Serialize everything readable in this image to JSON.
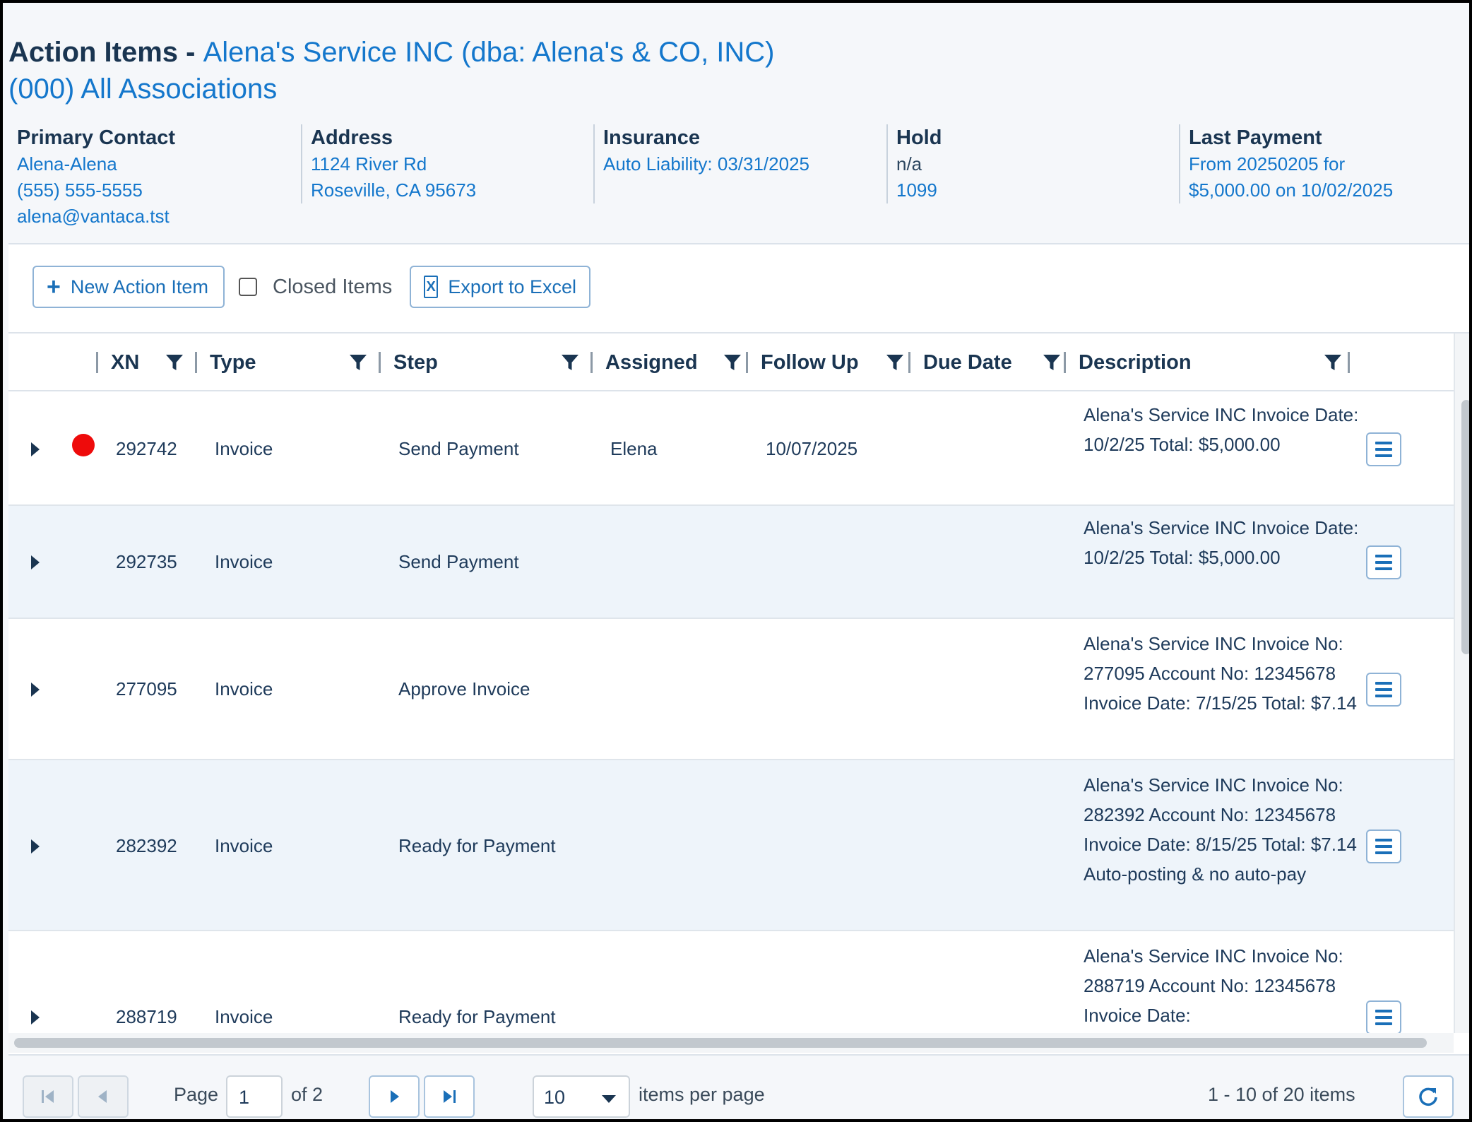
{
  "header": {
    "title_prefix": "Action Items - ",
    "vendor_name": "Alena's Service INC (dba: Alena's & CO, INC)",
    "association": "(000) All Associations"
  },
  "info": {
    "primary_contact": {
      "heading": "Primary Contact",
      "name": "Alena-Alena",
      "phone": "(555) 555-5555",
      "email": "alena@vantaca.tst"
    },
    "address": {
      "heading": "Address",
      "line1": "1124 River Rd",
      "line2": "Roseville, CA 95673"
    },
    "insurance": {
      "heading": "Insurance",
      "line1": "Auto Liability: 03/31/2025"
    },
    "hold": {
      "heading": "Hold",
      "value": "n/a",
      "link": "1099"
    },
    "last_payment": {
      "heading": "Last Payment",
      "line1": "From 20250205 for",
      "line2": "$5,000.00 on 10/02/2025"
    }
  },
  "toolbar": {
    "new_action_label": "New Action Item",
    "closed_items_label": "Closed Items",
    "export_label": "Export to Excel"
  },
  "columns": {
    "xn": "XN",
    "type": "Type",
    "step": "Step",
    "assigned": "Assigned",
    "follow_up": "Follow Up",
    "due_date": "Due Date",
    "description": "Description"
  },
  "rows": [
    {
      "xn": "292742",
      "type": "Invoice",
      "step": "Send Payment",
      "assigned": "Elena",
      "follow_up": "10/07/2025",
      "due_date": "",
      "description": "Alena's Service INC Invoice Date: 10/2/25 Total: $5,000.00",
      "flag": "red"
    },
    {
      "xn": "292735",
      "type": "Invoice",
      "step": "Send Payment",
      "assigned": "",
      "follow_up": "",
      "due_date": "",
      "description": "Alena's Service INC Invoice Date: 10/2/25 Total: $5,000.00"
    },
    {
      "xn": "277095",
      "type": "Invoice",
      "step": "Approve Invoice",
      "assigned": "",
      "follow_up": "",
      "due_date": "",
      "description": "Alena's Service INC Invoice No: 277095 Account No: 12345678 Invoice Date: 7/15/25 Total: $7.14"
    },
    {
      "xn": "282392",
      "type": "Invoice",
      "step": "Ready for Payment",
      "assigned": "",
      "follow_up": "",
      "due_date": "",
      "description": "Alena's Service INC Invoice No: 282392 Account No: 12345678 Invoice Date: 8/15/25 Total: $7.14 Auto-posting & no auto-pay"
    },
    {
      "xn": "288719",
      "type": "Invoice",
      "step": "Ready for Payment",
      "assigned": "",
      "follow_up": "",
      "due_date": "",
      "description": "Alena's Service INC Invoice No: 288719 Account No: 12345678 Invoice Date:"
    }
  ],
  "pager": {
    "page_label": "Page",
    "page_value": "1",
    "of_label": "of 2",
    "page_size": "10",
    "items_per_page_label": "items per page",
    "range_label": "1 - 10 of 20 items"
  },
  "colors": {
    "accent": "#1477cc",
    "flag_red": "#ee0b0b",
    "row_alt": "#eef4fa"
  }
}
